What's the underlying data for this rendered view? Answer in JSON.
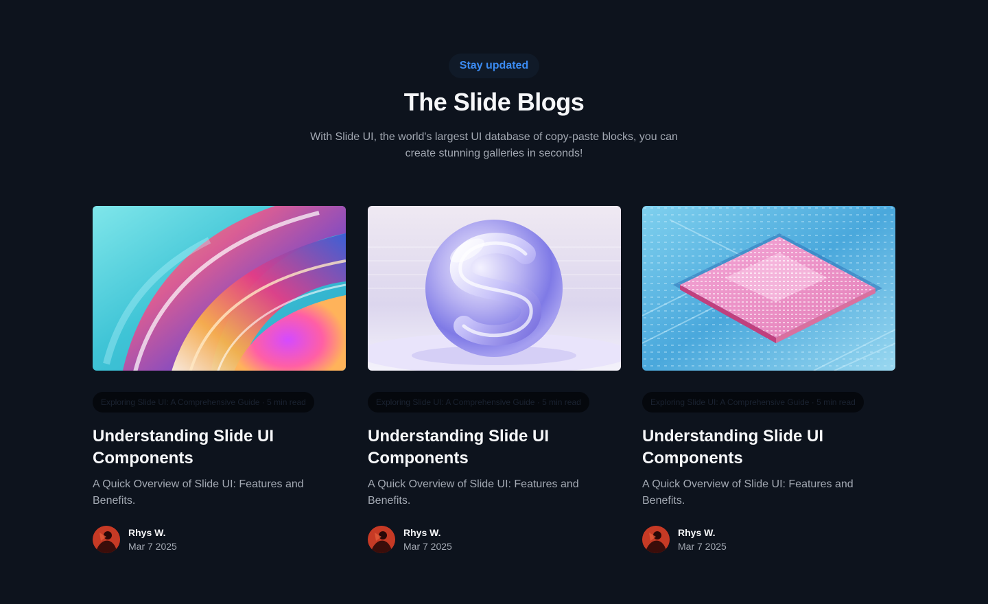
{
  "header": {
    "eyebrow": "Stay updated",
    "title": "The Slide Blogs",
    "subtitle": "With Slide UI, the world's largest UI database of copy-paste blocks, you can create stunning galleries in seconds!"
  },
  "posts": [
    {
      "image": "abstract-iridescent-swirl",
      "tag": "Exploring Slide UI: A Comprehensive Guide · 5 min read",
      "title": "Understanding Slide UI Components",
      "description": "A Quick Overview of Slide UI: Features and Benefits.",
      "author": "Rhys W.",
      "date": "Mar 7 2025"
    },
    {
      "image": "glass-sphere-s-shape",
      "tag": "Exploring Slide UI: A Comprehensive Guide · 5 min read",
      "title": "Understanding Slide UI Components",
      "description": "A Quick Overview of Slide UI: Features and Benefits.",
      "author": "Rhys W.",
      "date": "Mar 7 2025"
    },
    {
      "image": "circuit-chip-pastel",
      "tag": "Exploring Slide UI: A Comprehensive Guide · 5 min read",
      "title": "Understanding Slide UI Components",
      "description": "A Quick Overview of Slide UI: Features and Benefits.",
      "author": "Rhys W.",
      "date": "Mar 7 2025"
    }
  ],
  "colors": {
    "background": "#0d131d",
    "accent": "#3b8bf2",
    "text": "#f6f7f9",
    "muted": "#a3a9b3"
  }
}
